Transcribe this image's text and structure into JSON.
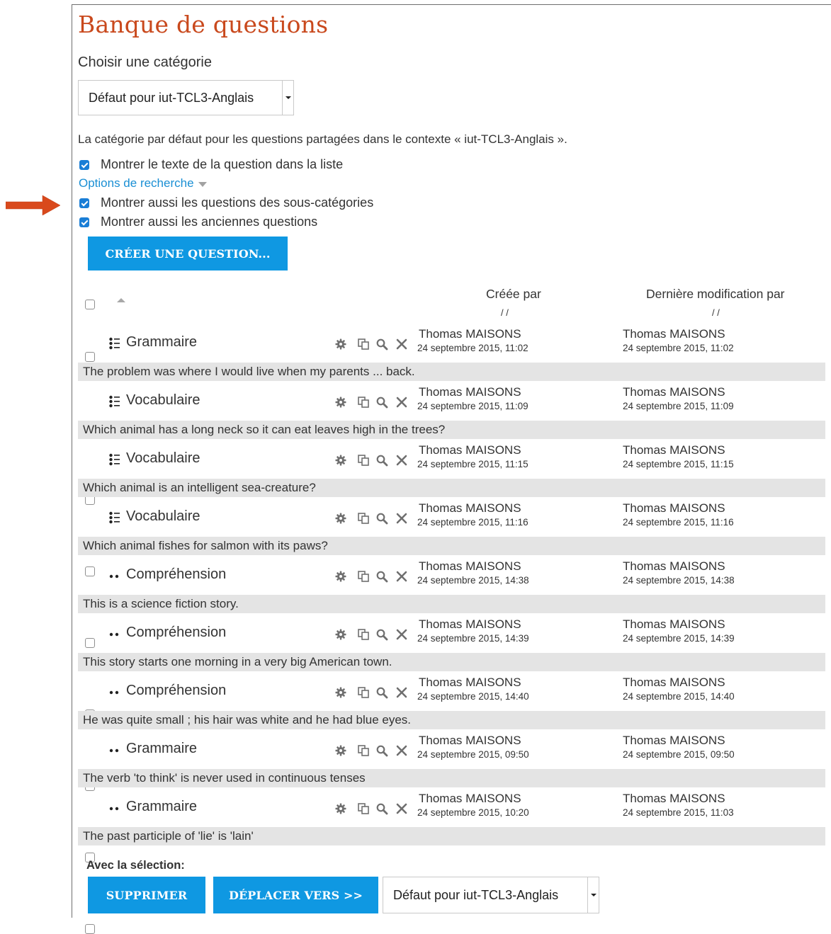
{
  "page": {
    "title": "Banque de questions",
    "choose_category_label": "Choisir une catégorie",
    "category_selected": "Défaut pour iut-TCL3-Anglais",
    "category_description": "La catégorie par défaut pour les questions partagées dans le contexte « iut-TCL3-Anglais ».",
    "show_question_text_label": "Montrer le texte de la question dans la liste",
    "show_question_text_checked": true,
    "search_options_label": "Options de recherche",
    "show_subcategories_label": "Montrer aussi les questions des sous-catégories",
    "show_subcategories_checked": true,
    "show_old_label": "Montrer aussi les anciennes questions",
    "show_old_checked": true,
    "create_button": "CRÉER UNE QUESTION..."
  },
  "table": {
    "col_created": "Créée par",
    "col_modified": "Dernière modification par",
    "slashes": "/       /",
    "rows": [
      {
        "type": "multichoice",
        "name": "Grammaire",
        "created_by": "Thomas MAISONS",
        "created_date": "24 septembre 2015, 11:02",
        "modified_by": "Thomas MAISONS",
        "modified_date": "24 septembre 2015, 11:02",
        "text": "The problem was where I would live when my parents ... back."
      },
      {
        "type": "multichoice",
        "name": "Vocabulaire",
        "created_by": "Thomas MAISONS",
        "created_date": "24 septembre 2015, 11:09",
        "modified_by": "Thomas MAISONS",
        "modified_date": "24 septembre 2015, 11:09",
        "text": "Which animal has a long neck so it can eat leaves high in the trees?"
      },
      {
        "type": "multichoice",
        "name": "Vocabulaire",
        "created_by": "Thomas MAISONS",
        "created_date": "24 septembre 2015, 11:15",
        "modified_by": "Thomas MAISONS",
        "modified_date": "24 septembre 2015, 11:15",
        "text": "Which animal is an intelligent sea-creature?"
      },
      {
        "type": "multichoice",
        "name": "Vocabulaire",
        "created_by": "Thomas MAISONS",
        "created_date": "24 septembre 2015, 11:16",
        "modified_by": "Thomas MAISONS",
        "modified_date": "24 septembre 2015, 11:16",
        "text": "Which animal fishes for salmon with its paws?"
      },
      {
        "type": "truefalse",
        "name": "Compréhension",
        "created_by": "Thomas MAISONS",
        "created_date": "24 septembre 2015, 14:38",
        "modified_by": "Thomas MAISONS",
        "modified_date": "24 septembre 2015, 14:38",
        "text": "This is a science fiction story."
      },
      {
        "type": "truefalse",
        "name": "Compréhension",
        "created_by": "Thomas MAISONS",
        "created_date": "24 septembre 2015, 14:39",
        "modified_by": "Thomas MAISONS",
        "modified_date": "24 septembre 2015, 14:39",
        "text": "This story starts one morning in a very big American town."
      },
      {
        "type": "truefalse",
        "name": "Compréhension",
        "created_by": "Thomas MAISONS",
        "created_date": "24 septembre 2015, 14:40",
        "modified_by": "Thomas MAISONS",
        "modified_date": "24 septembre 2015, 14:40",
        "text": "He was quite small ; his hair was white and he had blue eyes."
      },
      {
        "type": "truefalse",
        "name": "Grammaire",
        "created_by": "Thomas MAISONS",
        "created_date": "24 septembre 2015, 09:50",
        "modified_by": "Thomas MAISONS",
        "modified_date": "24 septembre 2015, 09:50",
        "text": "The verb 'to think' is never used in continuous tenses"
      },
      {
        "type": "truefalse",
        "name": "Grammaire",
        "created_by": "Thomas MAISONS",
        "created_date": "24 septembre 2015, 10:20",
        "modified_by": "Thomas MAISONS",
        "modified_date": "24 septembre 2015, 11:03",
        "text": "The past participle of 'lie' is 'lain'"
      }
    ]
  },
  "footer": {
    "with_selection_label": "Avec la sélection:",
    "delete_button": "SUPPRIMER",
    "move_button": "DÉPLACER VERS >>",
    "move_target": "Défaut pour iut-TCL3-Anglais"
  },
  "icons": {
    "multichoice": "multichoice-icon",
    "truefalse": "truefalse-icon",
    "actions": [
      "gear-icon",
      "copy-icon",
      "preview-icon",
      "delete-icon"
    ],
    "annotation": "arrow-right-icon"
  },
  "colors": {
    "title": "#c9491d",
    "button": "#0f98e2",
    "link": "#1a8fd4",
    "checkbox": "#1a7ed6",
    "row_band": "#e4e4e4",
    "arrow": "#d9491c"
  }
}
